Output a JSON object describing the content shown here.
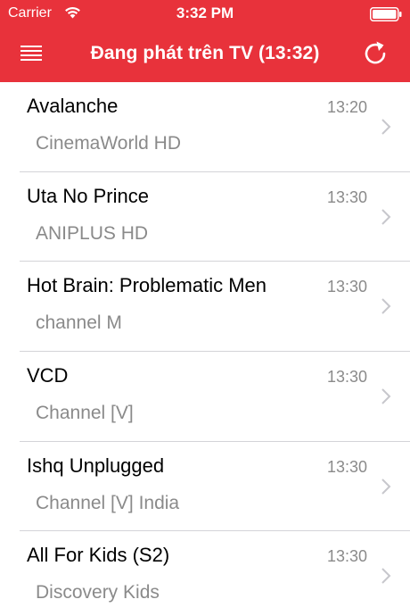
{
  "status_bar": {
    "carrier": "Carrier",
    "time": "3:32 PM"
  },
  "nav": {
    "title": "Đang phát trên TV (13:32)",
    "menu_icon": "hamburger-menu-icon",
    "refresh_icon": "refresh-icon"
  },
  "colors": {
    "header_bg": "#e8323b",
    "secondary_text": "#8a8a8a",
    "separator": "#d4d4d8"
  },
  "programs": [
    {
      "title": "Avalanche",
      "channel": "CinemaWorld HD",
      "time": "13:20"
    },
    {
      "title": "Uta No Prince",
      "channel": "ANIPLUS HD",
      "time": "13:30"
    },
    {
      "title": "Hot Brain: Problematic Men",
      "channel": "channel M",
      "time": "13:30"
    },
    {
      "title": "VCD",
      "channel": "Channel [V]",
      "time": "13:30"
    },
    {
      "title": "Ishq Unplugged",
      "channel": "Channel [V] India",
      "time": "13:30"
    },
    {
      "title": "All For Kids (S2)",
      "channel": "Discovery Kids",
      "time": "13:30"
    }
  ]
}
